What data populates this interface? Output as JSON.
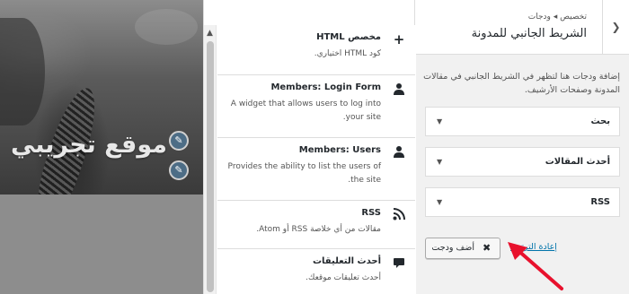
{
  "preview": {
    "site_title": "موقع تجريبي"
  },
  "widgets": [
    {
      "title": "HTML مخصص",
      "description": "كود HTML اختياري.",
      "icon": "plus-icon",
      "glyph": "+"
    },
    {
      "title": "Members: Login Form",
      "description": "A widget that allows users to log into your site.",
      "icon": "user-icon",
      "glyph": "👤"
    },
    {
      "title": "Members: Users",
      "description": "Provides the ability to list the users of the site.",
      "icon": "user-icon",
      "glyph": "👤"
    },
    {
      "title": "RSS",
      "description": "مقالات من أي خلاصة RSS أو Atom.",
      "icon": "rss-icon",
      "glyph": "◝"
    },
    {
      "title": "أحدث التعليقات",
      "description": "أحدث تعليقات موقعك.",
      "icon": "comment-icon",
      "glyph": "▰"
    }
  ],
  "panel": {
    "breadcrumb": "تخصيص ◂ ودجات",
    "title": "الشريط الجانبي للمدونة",
    "description": "إضافة ودجات هنا لتظهر في الشريط الجانبي في مقالات المدونة وصفحات الأرشيف.",
    "sidebar_widgets": [
      "بحث",
      "أحدث المقالات",
      "RSS"
    ],
    "add_widget_label": "أضف ودجت",
    "reorder_label": "إعادة الترتيب"
  },
  "colors": {
    "accent_link": "#0073aa",
    "annotation_arrow": "#e8112d"
  }
}
